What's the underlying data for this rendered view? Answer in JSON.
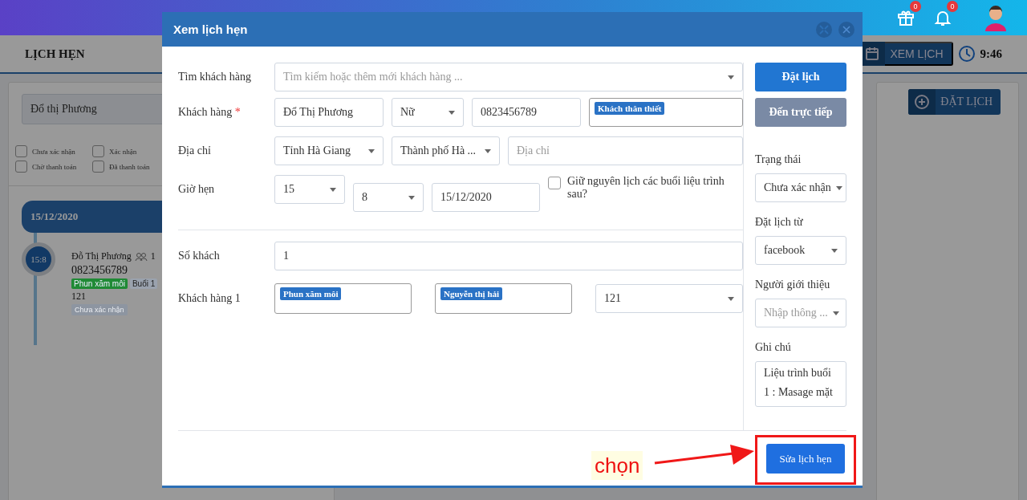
{
  "header": {
    "icons": [
      {
        "kind": "gift",
        "badge": "0"
      },
      {
        "kind": "bell",
        "badge": "0"
      }
    ]
  },
  "page": {
    "title": "LỊCH HẸN",
    "view_button": "XEM LỊCH",
    "time": "9:46"
  },
  "filter": {
    "search_value": "Đổ thị Phương",
    "statuses": [
      {
        "label": "Chưa xác nhận",
        "checked": false
      },
      {
        "label": "Xác nhận",
        "checked": false
      },
      {
        "label": "Chờ thanh toán",
        "checked": false
      },
      {
        "label": "Đã thanh toán",
        "checked": false
      }
    ]
  },
  "timeline": {
    "date": "15/12/2020",
    "appointments": [
      {
        "time": "15:8",
        "name": "Đỗ Thị Phương",
        "guests": "1",
        "phone": "0823456789",
        "tags": [
          {
            "label": "Phun xăm môi",
            "color": "#1f8a35"
          },
          {
            "label": "Buổi 1",
            "color": "#9aa2ae"
          }
        ],
        "room": "121",
        "status": "Chưa xác nhận"
      }
    ]
  },
  "right_panel": {
    "book_button": "ĐẶT LỊCH"
  },
  "modal": {
    "title": "Xem lịch hẹn",
    "find_customer": {
      "label": "Tìm khách hàng",
      "placeholder": "Tìm kiếm hoặc thêm mới khách hàng ..."
    },
    "customer": {
      "label": "Khách hàng",
      "required_mark": "*",
      "name": "Đổ Thị Phương",
      "gender": "Nữ",
      "phone": "0823456789",
      "tags": [
        "Khách thân thiết"
      ]
    },
    "address": {
      "label": "Địa chỉ",
      "province": "Tỉnh Hà Giang",
      "city": "Thành phố Hà ...",
      "placeholder": "Địa chỉ"
    },
    "time": {
      "label": "Giờ hẹn",
      "hour": "15",
      "minute": "8",
      "date": "15/12/2020",
      "keep_schedule": {
        "label": "Giữ nguyên lịch các buổi liệu trình sau?",
        "checked": false
      }
    },
    "guests": {
      "label": "Số khách",
      "value": "1"
    },
    "guest_rows": [
      {
        "label": "Khách hàng 1",
        "service": "Phun xăm môi",
        "staff": "Nguyễn thị hải",
        "room": "121"
      }
    ],
    "side_buttons": [
      {
        "label": "Đặt lịch",
        "selected": true
      },
      {
        "label": "Đến trực tiếp",
        "selected": false
      }
    ],
    "status": {
      "label": "Trạng thái",
      "value": "Chưa xác nhận"
    },
    "source": {
      "label": "Đặt lịch từ",
      "value": "facebook"
    },
    "referrer": {
      "label": "Người giới thiệu",
      "placeholder": "Nhập thông ..."
    },
    "note": {
      "label": "Ghi chú",
      "value": "Liệu trình buổi 1 : Masage mặt"
    },
    "save_button": "Sửa lịch hẹn"
  },
  "annotation": {
    "label": "chọn"
  }
}
